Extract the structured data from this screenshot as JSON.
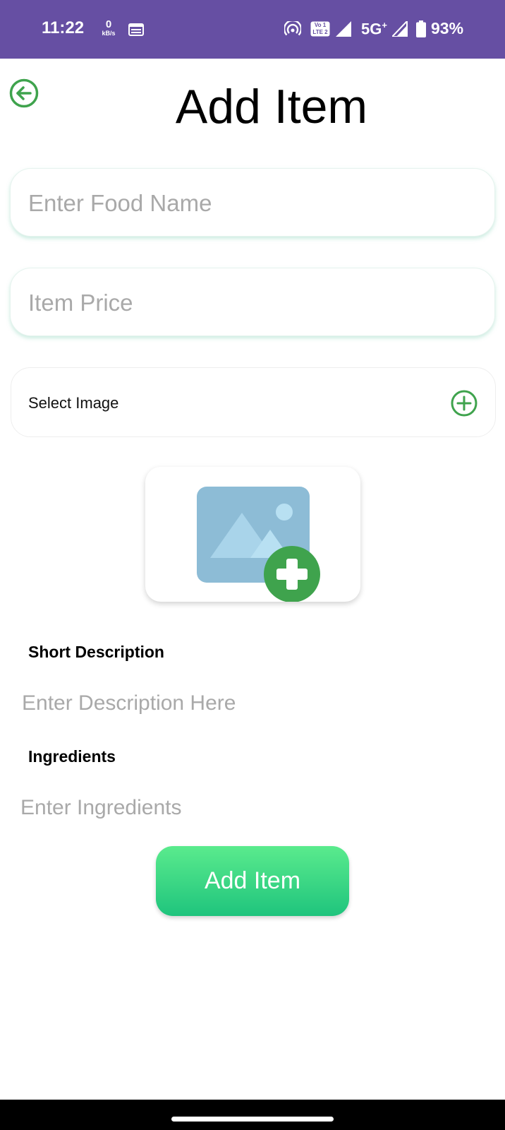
{
  "status_bar": {
    "time": "11:22",
    "data_speed": "0",
    "data_unit": "kB/s",
    "network": "5G",
    "network_plus": "+",
    "battery": "93%",
    "volte_line1": "Vo 1",
    "volte_line2": "LTE 2",
    "icons": [
      "calendar-icon",
      "hotspot-icon",
      "volte-icon",
      "signal-icon",
      "battery-icon"
    ]
  },
  "header": {
    "title": "Add Item",
    "back_icon": "back-arrow-icon"
  },
  "form": {
    "food_name_placeholder": "Enter Food Name",
    "price_placeholder": "Item Price",
    "select_image_label": "Select Image",
    "select_image_icon": "add-circle-icon",
    "image_placeholder_icon": "add-image-icon",
    "short_description_label": "Short Description",
    "description_placeholder": "Enter Description Here",
    "ingredients_label": "Ingredients",
    "ingredients_placeholder": "Enter Ingredients",
    "submit_label": "Add Item"
  },
  "colors": {
    "status_bar": "#664fa3",
    "accent_green": "#3fa34d",
    "button_gradient_top": "#5aeb8d",
    "button_gradient_bottom": "#1fc47d",
    "image_placeholder_bg": "#8dbcd6",
    "placeholder_text": "#a9a9a9"
  }
}
